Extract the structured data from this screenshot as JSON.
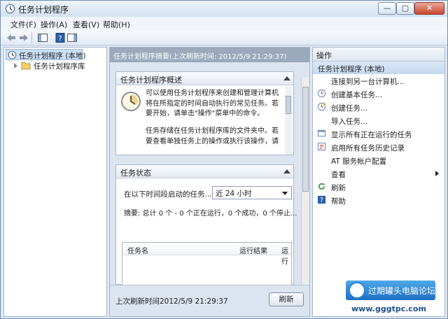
{
  "window": {
    "title": "任务计划程序",
    "minimize": "—",
    "maximize": "▢",
    "close": "✕"
  },
  "menu": {
    "file": "文件(F)",
    "action": "操作(A)",
    "view": "查看(V)",
    "help": "帮助(H)"
  },
  "tree": {
    "root": "任务计划程序 (本地)",
    "library": "任务计划程序库"
  },
  "center": {
    "header": "任务计划程序摘要(上次刷新时间: 2012/5/9 21:29:37)",
    "overview": {
      "title": "任务计划程序概述",
      "text1": "可以使用任务计划程序来创建和管理计算机将在所指定的时间自动执行的常见任务。若要开始，请单击\"操作\"菜单中的命令。",
      "text2": "任务存储在任务计划程序库的文件夹中。若要查看单独任务上的操作或执行该操作，请"
    },
    "status": {
      "title": "任务状态",
      "label": "在以下时间段启动的任务...",
      "period": "近 24 小时",
      "summary": "摘要: 总计 0 个 - 0 个正在运行，0 个成功，0 个停止...",
      "columns": [
        "任务名",
        "运行结果",
        "运行"
      ]
    },
    "footer": {
      "refresh_time": "上次刷新时间2012/5/9 21:29:37",
      "refresh_button": "刷新"
    }
  },
  "actions": {
    "title": "操作",
    "group": "任务计划程序 (本地)",
    "items": [
      {
        "label": "连接到另一台计算机...",
        "icon": "none"
      },
      {
        "label": "创建基本任务...",
        "icon": "basic-task-icon"
      },
      {
        "label": "创建任务...",
        "icon": "task-icon"
      },
      {
        "label": "导入任务...",
        "icon": "none"
      },
      {
        "label": "显示所有正在运行的任务",
        "icon": "running-tasks-icon"
      },
      {
        "label": "启用所有任务历史记录",
        "icon": "history-icon"
      },
      {
        "label": "AT 服务帐户配置",
        "icon": "none"
      },
      {
        "label": "查看",
        "icon": "none"
      },
      {
        "label": "刷新",
        "icon": "refresh-icon"
      },
      {
        "label": "帮助",
        "icon": "help-icon"
      }
    ]
  },
  "watermark": {
    "name": "过期罐头电脑论坛",
    "url": "www.gggtpc.com"
  },
  "colors": {
    "accent": "#2a6fc4",
    "selection": "#cde0f7",
    "panel": "#dbe4ef"
  }
}
